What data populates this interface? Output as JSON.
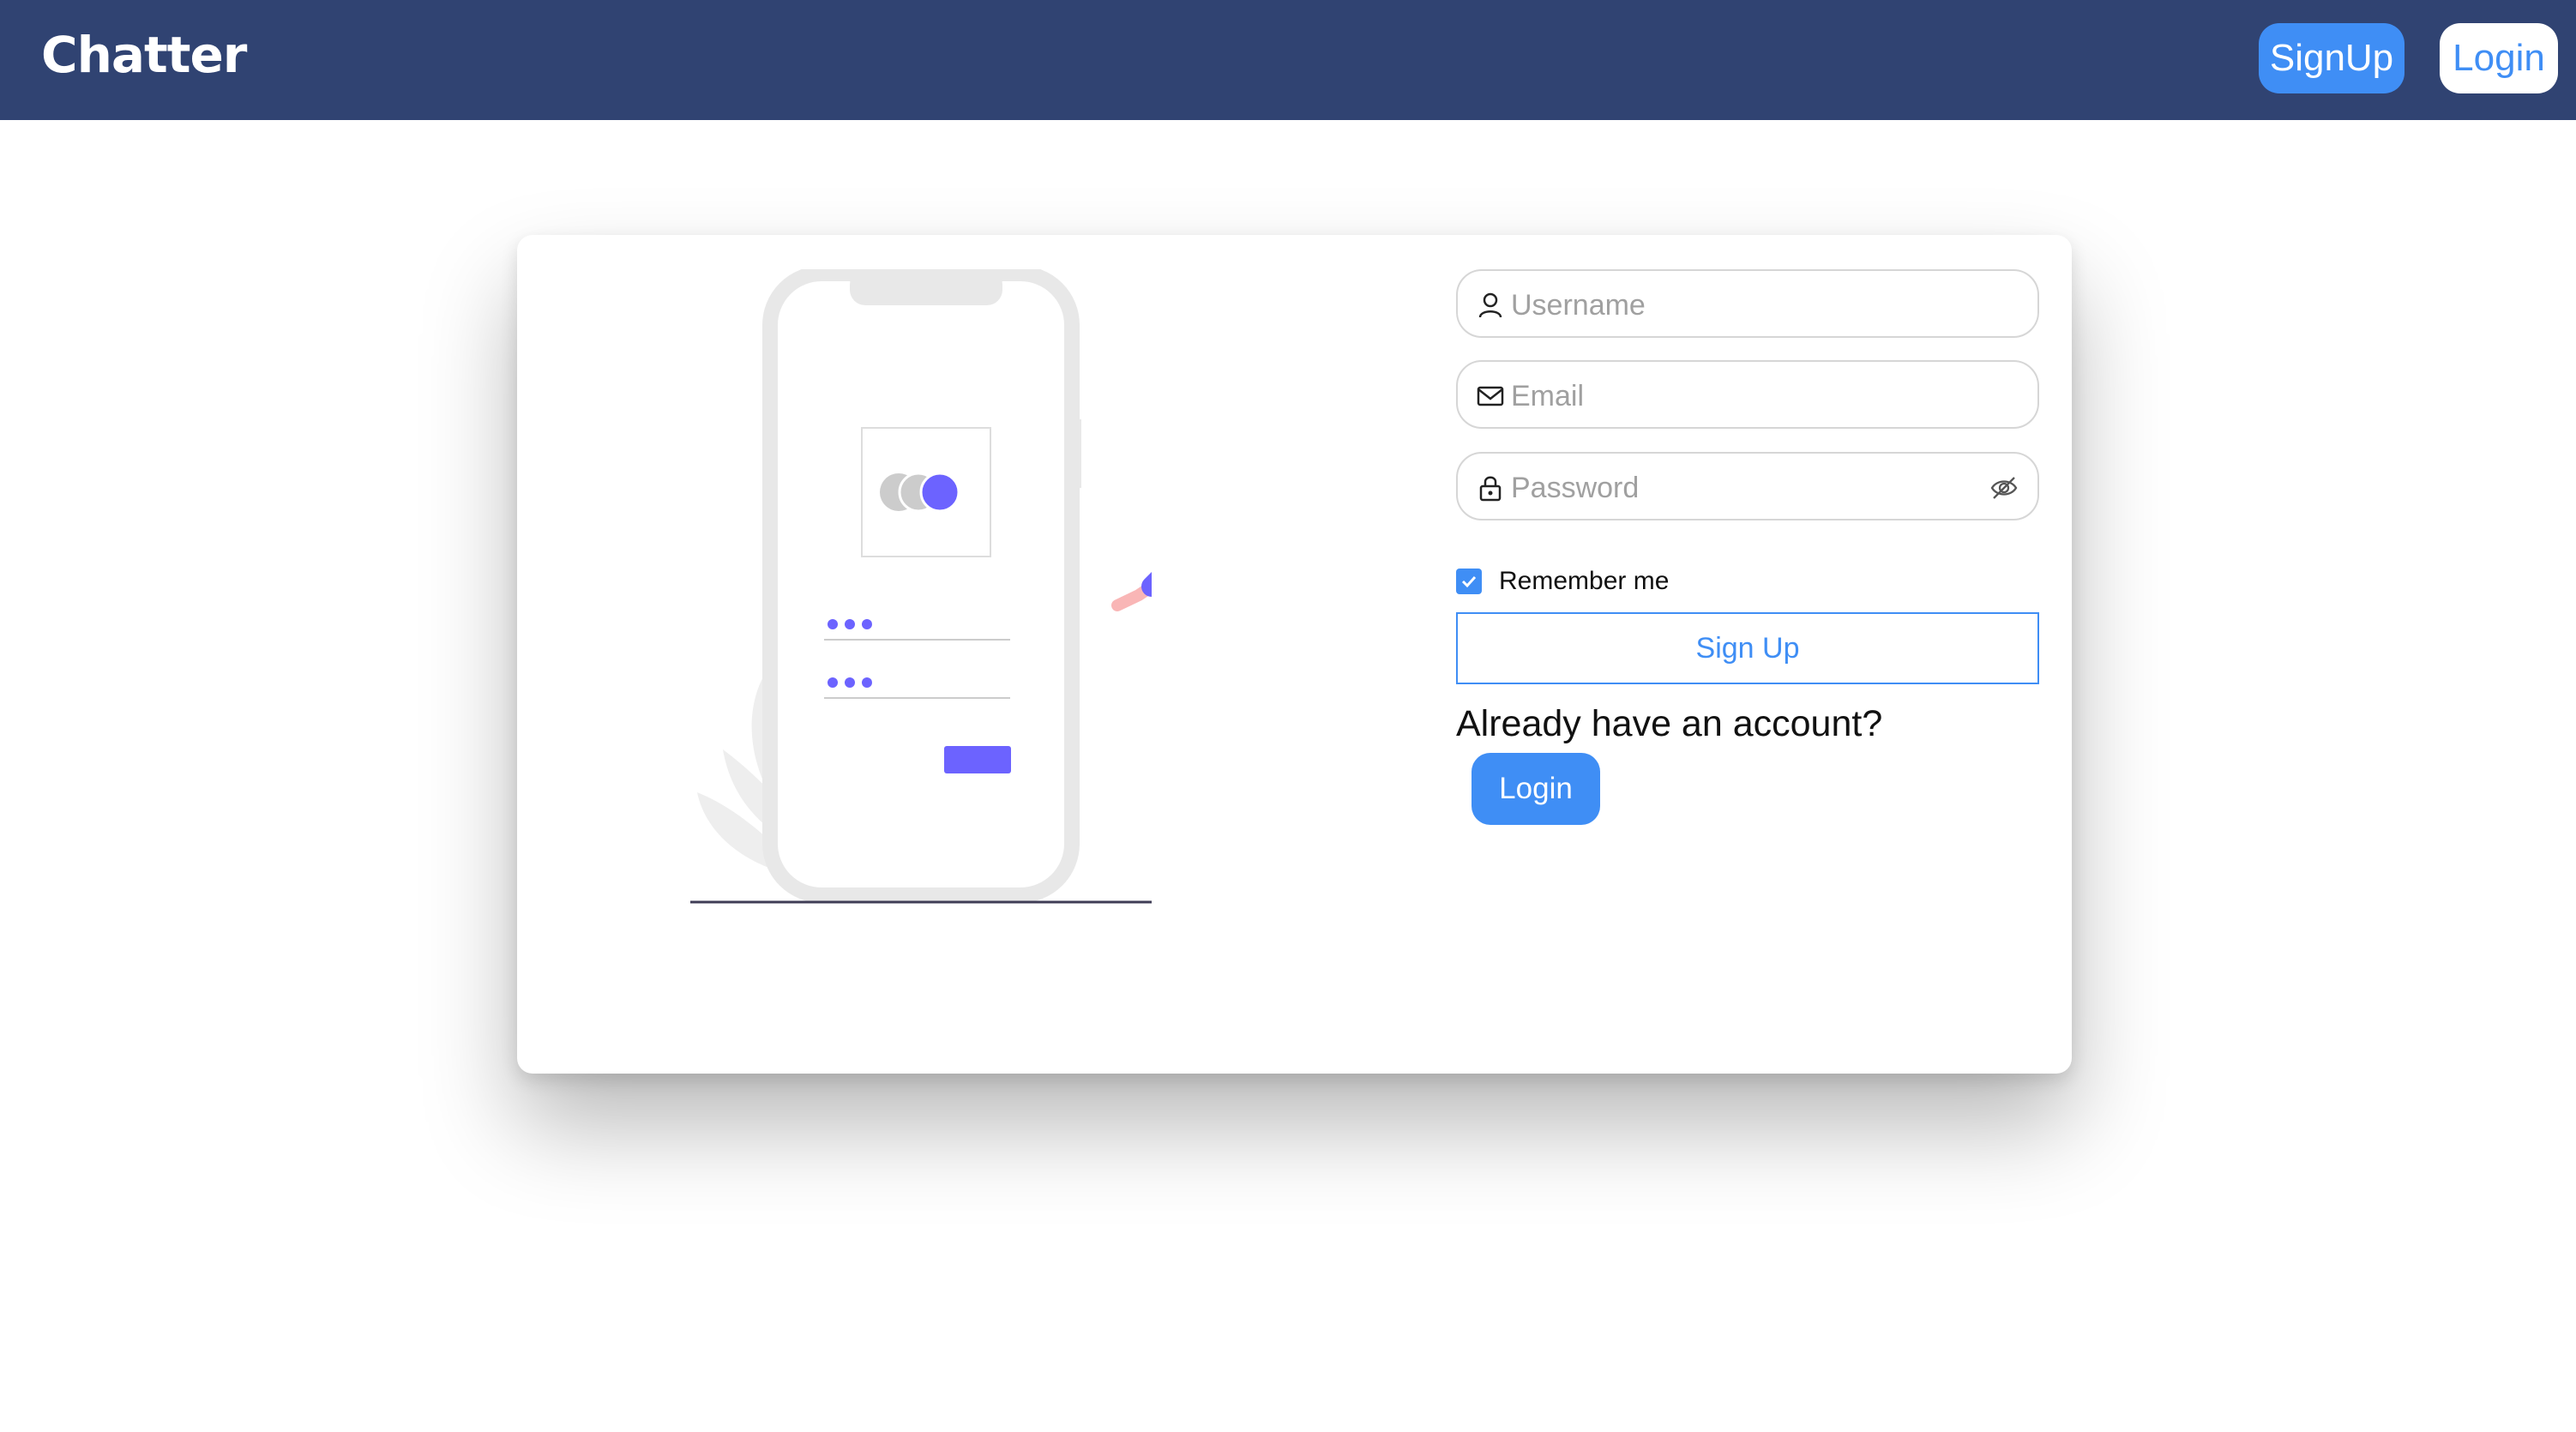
{
  "app": {
    "brand": "Chatter"
  },
  "header": {
    "signup_label": "SignUp",
    "login_label": "Login"
  },
  "form": {
    "username_placeholder": "Username",
    "email_placeholder": "Email",
    "password_placeholder": "Password",
    "remember_label": "Remember me",
    "remember_checked": true,
    "signup_button": "Sign Up",
    "already_text": "Already have an account?",
    "login_button": "Login"
  },
  "icons": {
    "username": "user-icon",
    "email": "envelope-icon",
    "password": "lock-icon",
    "toggle": "eye-slash-icon",
    "checkbox": "check-icon"
  },
  "colors": {
    "navbar": "#304372",
    "accent": "#3f8ef5",
    "illustration_accent": "#6c63ff"
  }
}
